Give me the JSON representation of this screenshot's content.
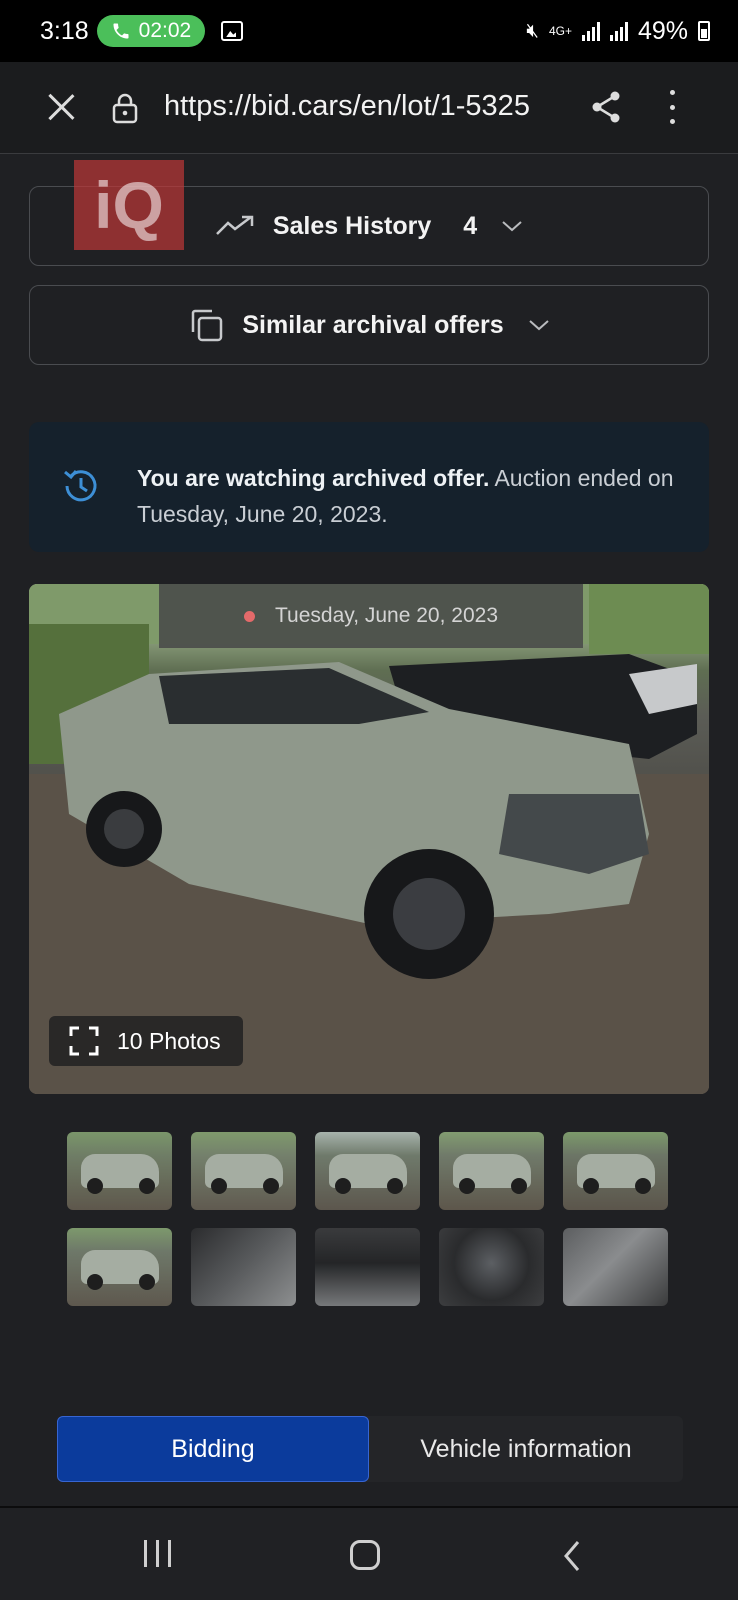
{
  "status_bar": {
    "time": "3:18",
    "call_timer": "02:02",
    "network": "4G+",
    "battery": "49%"
  },
  "browser": {
    "url": "https://bid.cars/en/lot/1-5325"
  },
  "logo": {
    "text": "iQ"
  },
  "accordions": {
    "sales_history": {
      "label": "Sales History",
      "count": "4"
    },
    "similar_offers": {
      "label": "Similar archival offers"
    }
  },
  "archive_note": {
    "bold": "You are watching archived offer.",
    "rest": " Auction ended on Tuesday, June 20, 2023."
  },
  "gallery": {
    "date_banner": "Tuesday, June 20, 2023",
    "photos_label": "10 Photos",
    "thumbnail_count": 10
  },
  "tabs": {
    "bidding": "Bidding",
    "vehicle_info": "Vehicle information"
  },
  "colors": {
    "accent_blue": "#0b3b9c",
    "call_green": "#4bbf5a",
    "info_blue": "#3d8fd6",
    "background": "#1f2023"
  }
}
